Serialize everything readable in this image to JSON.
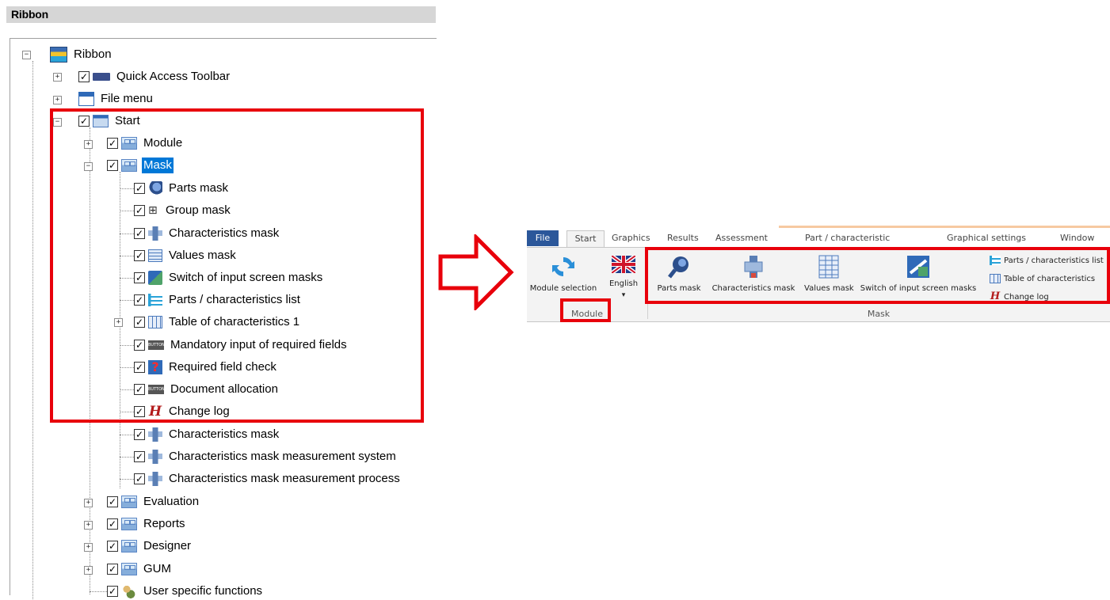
{
  "header": {
    "title": "Ribbon"
  },
  "tree": {
    "ribbon": "Ribbon",
    "quick_access": "Quick Access Toolbar",
    "file_menu": "File menu",
    "start": "Start",
    "module": "Module",
    "mask": "Mask",
    "mask_children": [
      "Parts mask",
      "Group mask",
      "Characteristics mask",
      "Values mask",
      "Switch of input screen masks",
      "Parts / characteristics list",
      "Table of characteristics 1",
      "Mandatory input of required fields",
      "Required field check",
      "Document allocation",
      "Change log",
      "Characteristics mask",
      "Characteristics mask measurement system",
      "Characteristics mask measurement process"
    ],
    "evaluation": "Evaluation",
    "reports": "Reports",
    "designer": "Designer",
    "gum": "GUM",
    "user_specific": "User specific functions",
    "check": "✓"
  },
  "ribbon_ui": {
    "tabs": [
      "File",
      "Start",
      "Graphics",
      "Results",
      "Assessment",
      "Part / characteristic",
      "Graphical settings",
      "Window"
    ],
    "module_group": {
      "label": "Module",
      "buttons": [
        "Module selection",
        "English"
      ],
      "dropdown": "▾"
    },
    "mask_group": {
      "label": "Mask",
      "buttons": [
        "Parts mask",
        "Characteristics mask",
        "Values mask",
        "Switch of input screen masks"
      ],
      "small_buttons": [
        "Parts / characteristics list",
        "Table of characteristics",
        "Change log"
      ]
    }
  },
  "colors": {
    "highlight": "#e8000b",
    "selection": "#0078d7",
    "file_tab": "#2b579a"
  }
}
